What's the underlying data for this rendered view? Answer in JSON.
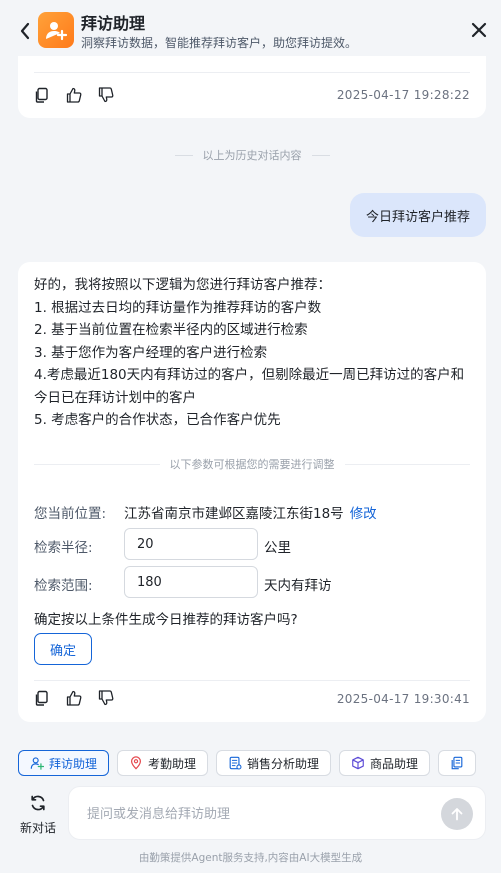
{
  "header": {
    "title": "拜访助理",
    "subtitle": "洞察拜访数据，智能推荐拜访客户，助您拜访提效。"
  },
  "previous_card": {
    "timestamp": "2025-04-17 19:28:22"
  },
  "history_separator": "以上为历史对话内容",
  "user_message": "今日拜访客户推荐",
  "assistant_reply": {
    "lines": [
      "好的，我将按照以下逻辑为您进行拜访客户推荐：",
      "1. 根据过去日均的拜访量作为推荐拜访的客户数",
      "2. 基于当前位置在检索半径内的区域进行检索",
      "3. 基于您作为客户经理的客户进行检索",
      "4.考虑最近180天内有拜访过的客户，但剔除最近一周已拜访过的客户和今日已在拜访计划中的客户",
      "5. 考虑客户的合作状态，已合作客户优先"
    ],
    "param_separator": "以下参数可根据您的需要进行调整",
    "location_label": "您当前位置:",
    "location_value": "江苏省南京市建邺区嘉陵江东街18号",
    "edit_link": "修改",
    "radius_label": "检索半径:",
    "radius_value": "20",
    "radius_unit": "公里",
    "range_label": "检索范围:",
    "range_value": "180",
    "range_unit": "天内有拜访",
    "confirm_question": "确定按以上条件生成今日推荐的拜访客户吗?",
    "confirm_button": "确定",
    "timestamp": "2025-04-17 19:30:41"
  },
  "assistants": [
    {
      "label": "拜访助理",
      "icon": "people-add-icon",
      "active": true
    },
    {
      "label": "考勤助理",
      "icon": "location-pin-icon",
      "active": false
    },
    {
      "label": "销售分析助理",
      "icon": "document-chart-icon",
      "active": false
    },
    {
      "label": "商品助理",
      "icon": "cube-icon",
      "active": false
    },
    {
      "label": "",
      "icon": "documents-icon",
      "active": false
    }
  ],
  "new_chat_label": "新对话",
  "input": {
    "placeholder": "提问或发消息给拜访助理"
  },
  "footer": "由勤策提供Agent服务支持,内容由AI大模型生成",
  "colors": {
    "accent": "#1565d8",
    "logo": "#ff8a24",
    "user_bubble": "#dbe6fb"
  }
}
